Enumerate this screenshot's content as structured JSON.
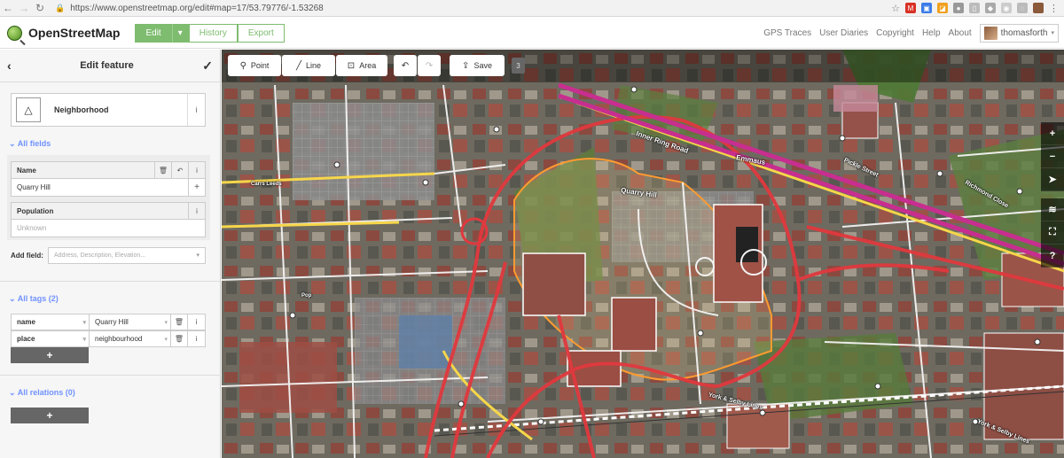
{
  "browser": {
    "url": "https://www.openstreetmap.org/edit#map=17/53.79776/-1.53268"
  },
  "header": {
    "brand": "OpenStreetMap",
    "tabs": {
      "edit": "Edit",
      "history": "History",
      "export": "Export"
    },
    "nav": {
      "gps_traces": "GPS Traces",
      "user_diaries": "User Diaries",
      "copyright": "Copyright",
      "help": "Help",
      "about": "About"
    },
    "username": "thomasforth"
  },
  "sidebar": {
    "title": "Edit feature",
    "preset": {
      "name": "Neighborhood"
    },
    "all_fields_label": "All fields",
    "fields": {
      "name_label": "Name",
      "name_value": "Quarry Hill",
      "population_label": "Population",
      "population_placeholder": "Unknown"
    },
    "add_field": {
      "label": "Add field:",
      "placeholder": "Address, Description, Elevation..."
    },
    "all_tags_label": "All tags (2)",
    "tags": [
      {
        "key": "name",
        "value": "Quarry Hill"
      },
      {
        "key": "place",
        "value": "neighbourhood"
      }
    ],
    "all_relations_label": "All relations (0)"
  },
  "toolbar": {
    "point": "Point",
    "line": "Line",
    "area": "Area",
    "save": "Save",
    "edit_count": "3"
  },
  "map_labels": {
    "inner_ring_road": "Inner Ring Road",
    "emmaus": "Emmaus",
    "quarry_hill": "Quarry Hill",
    "carrs_leeds": "Carrs Leeds",
    "pop": "Pop",
    "york_selby_lines_1": "York & Selby Lines",
    "york_selby_lines_2": "York & Selby Lines",
    "richmond_close": "Richmond Close",
    "pickle_street": "Pickle Street"
  }
}
